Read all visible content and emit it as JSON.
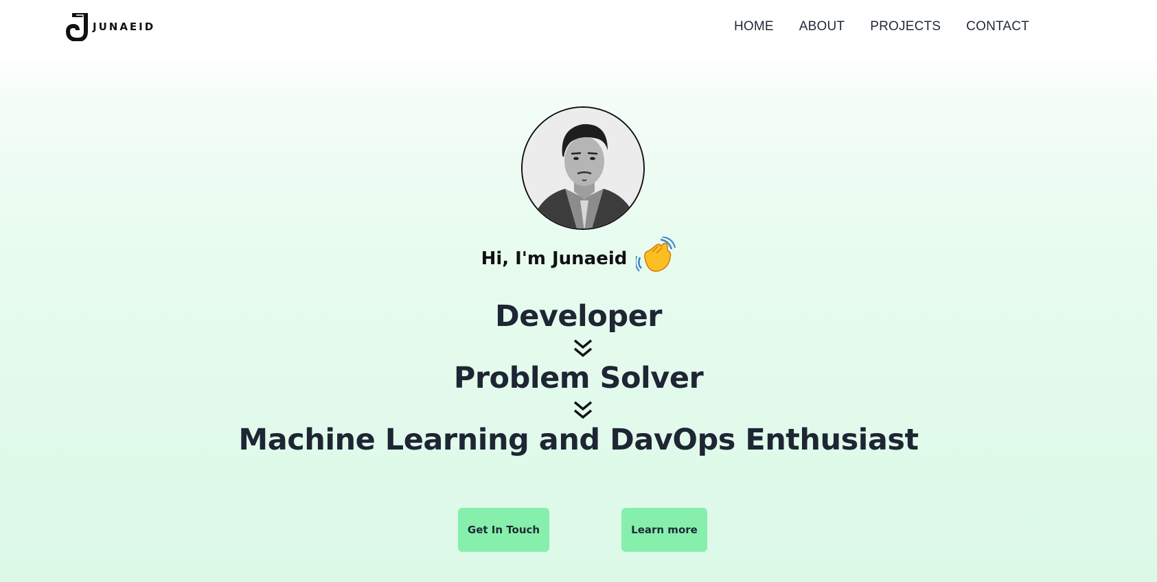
{
  "brand": {
    "name": "JUNAEID",
    "logo_icon": "j-monogram-icon"
  },
  "nav": {
    "items": [
      {
        "label": "HOME"
      },
      {
        "label": "ABOUT"
      },
      {
        "label": "PROJECTS"
      },
      {
        "label": "CONTACT"
      }
    ]
  },
  "hero": {
    "avatar_alt": "profile-photo",
    "greeting": "Hi, I'm Junaeid",
    "greeting_emoji": "waving-hand-icon",
    "roles": [
      "Developer",
      "Problem Solver",
      "Machine Learning and DavOps Enthusiast"
    ],
    "separator_icon": "double-chevron-down-icon"
  },
  "actions": {
    "primary_label": "Get In Touch",
    "secondary_label": "Learn more"
  },
  "colors": {
    "accent": "#86efac",
    "text": "#1e2533",
    "background_tint": "#e6fbee"
  }
}
